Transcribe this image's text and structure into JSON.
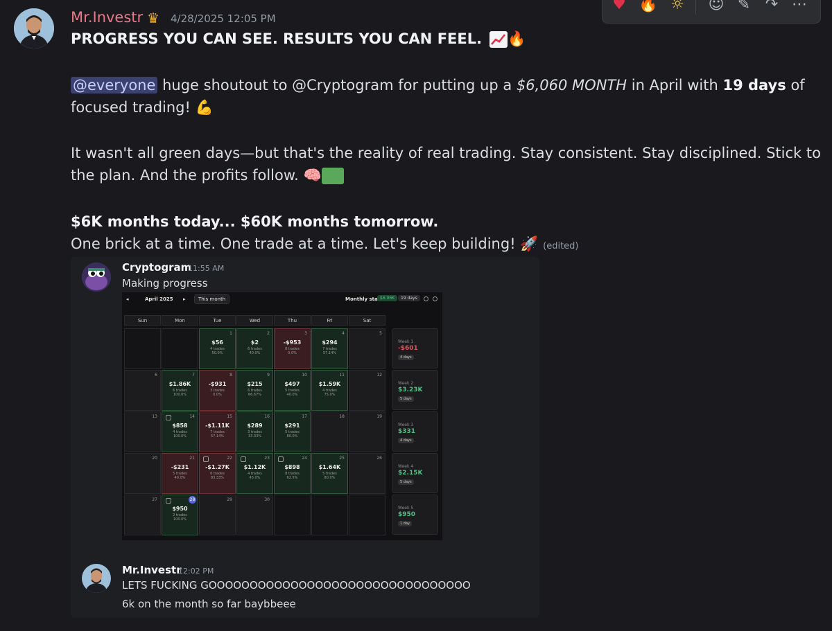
{
  "message": {
    "author": "Mr.Investr",
    "timestamp": "4/28/2025 12:05 PM",
    "headline": "PROGRESS YOU CAN SEE. RESULTS YOU CAN FEEL.",
    "p1_mention": "@everyone",
    "p1_a": "huge shoutout to @Cryptogram for putting up a",
    "p1_amount": "$6,060 MONTH",
    "p1_b": "in April with",
    "p1_days": "19 days",
    "p1_c": "of",
    "p1_line2": "focused trading!",
    "p2_line1": "It wasn't all green days—but that's the reality of real trading. Stay consistent. Stay disciplined. Stick to",
    "p2_line2": "the plan. And the profits follow.",
    "p3_bold": "$6K months today... $60K months tomorrow.",
    "p3_line2": "One brick at a time. One trade at a time. Let's keep building!",
    "edited": "(edited)"
  },
  "embed": {
    "author": "Cryptogram",
    "timestamp": "11:55 AM",
    "text": "Making progress"
  },
  "calendar": {
    "month": "April 2025",
    "this_month": "This month",
    "monthly_stats_label": "Monthly stats:",
    "monthly_total": "$6.06K",
    "monthly_days": "19 days",
    "weekdays": [
      "Sun",
      "Mon",
      "Tue",
      "Wed",
      "Thu",
      "Fri",
      "Sat"
    ],
    "weeks": [
      {
        "label": "Week 1",
        "value": "-$601",
        "days": "4 days",
        "sign": "neg"
      },
      {
        "label": "Week 2",
        "value": "$3.23K",
        "days": "5 days",
        "sign": "pos"
      },
      {
        "label": "Week 3",
        "value": "$331",
        "days": "4 days",
        "sign": "pos"
      },
      {
        "label": "Week 4",
        "value": "$2.15K",
        "days": "5 days",
        "sign": "pos"
      },
      {
        "label": "Week 5",
        "value": "$950",
        "days": "1 day",
        "sign": "pos"
      }
    ],
    "cells": [
      {
        "day": "",
        "state": "dim"
      },
      {
        "day": "",
        "state": "dim"
      },
      {
        "day": "1",
        "state": "pos",
        "pnl": "$56",
        "trades": "4 trades",
        "rate": "50.0%"
      },
      {
        "day": "2",
        "state": "pos",
        "pnl": "$2",
        "trades": "6 trades",
        "rate": "40.0%"
      },
      {
        "day": "3",
        "state": "neg",
        "pnl": "-$953",
        "trades": "8 trades",
        "rate": "0.0%"
      },
      {
        "day": "4",
        "state": "pos",
        "pnl": "$294",
        "trades": "7 trades",
        "rate": "57.14%"
      },
      {
        "day": "5",
        "state": "empty"
      },
      {
        "day": "6",
        "state": "empty"
      },
      {
        "day": "7",
        "state": "pos",
        "pnl": "$1.86K",
        "trades": "6 trades",
        "rate": "100.0%"
      },
      {
        "day": "8",
        "state": "neg",
        "pnl": "-$931",
        "trades": "3 trades",
        "rate": "0.0%"
      },
      {
        "day": "9",
        "state": "pos",
        "pnl": "$215",
        "trades": "6 trades",
        "rate": "66.67%"
      },
      {
        "day": "10",
        "state": "pos",
        "pnl": "$497",
        "trades": "5 trades",
        "rate": "40.0%"
      },
      {
        "day": "11",
        "state": "pos",
        "pnl": "$1.59K",
        "trades": "4 trades",
        "rate": "75.0%"
      },
      {
        "day": "12",
        "state": "empty"
      },
      {
        "day": "13",
        "state": "empty"
      },
      {
        "day": "14",
        "state": "pos",
        "pnl": "$858",
        "trades": "4 trades",
        "rate": "100.0%",
        "note": true
      },
      {
        "day": "15",
        "state": "neg",
        "pnl": "-$1.11K",
        "trades": "7 trades",
        "rate": "57.14%"
      },
      {
        "day": "16",
        "state": "pos",
        "pnl": "$289",
        "trades": "3 trades",
        "rate": "33.33%"
      },
      {
        "day": "17",
        "state": "pos",
        "pnl": "$291",
        "trades": "5 trades",
        "rate": "80.0%"
      },
      {
        "day": "18",
        "state": "empty"
      },
      {
        "day": "19",
        "state": "empty"
      },
      {
        "day": "20",
        "state": "empty"
      },
      {
        "day": "21",
        "state": "neg",
        "pnl": "-$231",
        "trades": "5 trades",
        "rate": "40.0%"
      },
      {
        "day": "22",
        "state": "neg",
        "pnl": "-$1.27K",
        "trades": "6 trades",
        "rate": "83.33%",
        "note": true
      },
      {
        "day": "23",
        "state": "pos",
        "pnl": "$1.12K",
        "trades": "4 trades",
        "rate": "45.0%",
        "note": true
      },
      {
        "day": "24",
        "state": "pos",
        "pnl": "$898",
        "trades": "8 trades",
        "rate": "62.5%",
        "note": true
      },
      {
        "day": "25",
        "state": "pos",
        "pnl": "$1.64K",
        "trades": "5 trades",
        "rate": "80.0%"
      },
      {
        "day": "26",
        "state": "empty"
      },
      {
        "day": "27",
        "state": "empty"
      },
      {
        "day": "28",
        "state": "pos",
        "pnl": "$950",
        "trades": "2 trades",
        "rate": "100.0%",
        "note": true,
        "today": true
      },
      {
        "day": "29",
        "state": "empty"
      },
      {
        "day": "30",
        "state": "empty"
      },
      {
        "day": "",
        "state": "dim"
      },
      {
        "day": "",
        "state": "dim"
      },
      {
        "day": "",
        "state": "dim"
      }
    ]
  },
  "reply": {
    "author": "Mr.Investr",
    "timestamp": "12:02 PM",
    "line1": "LETS FUCKING GOOOOOOOOOOOOOOOOOOOOOOOOOOOOOOOO",
    "line2": "6k on the month so far baybbeee"
  },
  "colors": {
    "author": "#e8788a",
    "positive": "#4fbf84",
    "negative": "#e0535e",
    "mention_bg": "#3c4270"
  },
  "icons": [
    "crown-icon",
    "heart-reaction-icon",
    "fire-reaction-icon",
    "sun-reaction-icon",
    "add-reaction-icon",
    "edit-icon",
    "forward-icon",
    "more-icon",
    "chart-up-icon",
    "fire-icon",
    "flexed-bicep-icon",
    "brain-icon",
    "money-icon",
    "rocket-icon"
  ]
}
